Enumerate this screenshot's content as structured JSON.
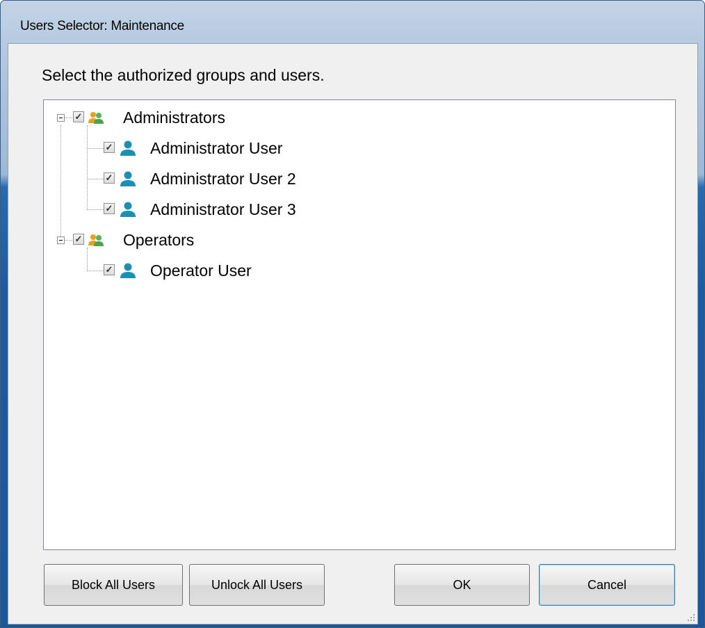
{
  "window": {
    "title": "Users Selector: Maintenance"
  },
  "instruction": "Select the authorized groups and users.",
  "tree": {
    "groups": [
      {
        "label": "Administrators",
        "checked": true,
        "expanded": true,
        "icon": "user-group-icon",
        "users": [
          {
            "label": "Administrator User",
            "checked": true,
            "icon": "user-icon"
          },
          {
            "label": "Administrator User 2",
            "checked": true,
            "icon": "user-icon"
          },
          {
            "label": "Administrator User 3",
            "checked": true,
            "icon": "user-icon"
          }
        ]
      },
      {
        "label": "Operators",
        "checked": true,
        "expanded": true,
        "icon": "user-group-icon",
        "users": [
          {
            "label": "Operator User",
            "checked": true,
            "icon": "user-icon"
          }
        ]
      }
    ]
  },
  "buttons": {
    "block_all": "Block All Users",
    "unlock_all": "Unlock All Users",
    "ok": "OK",
    "cancel": "Cancel"
  },
  "colors": {
    "titlebar": "#b6cae0",
    "frame": "#1e5a9e",
    "client": "#f0f0f0",
    "default_button_border": "#3c7fb1"
  }
}
